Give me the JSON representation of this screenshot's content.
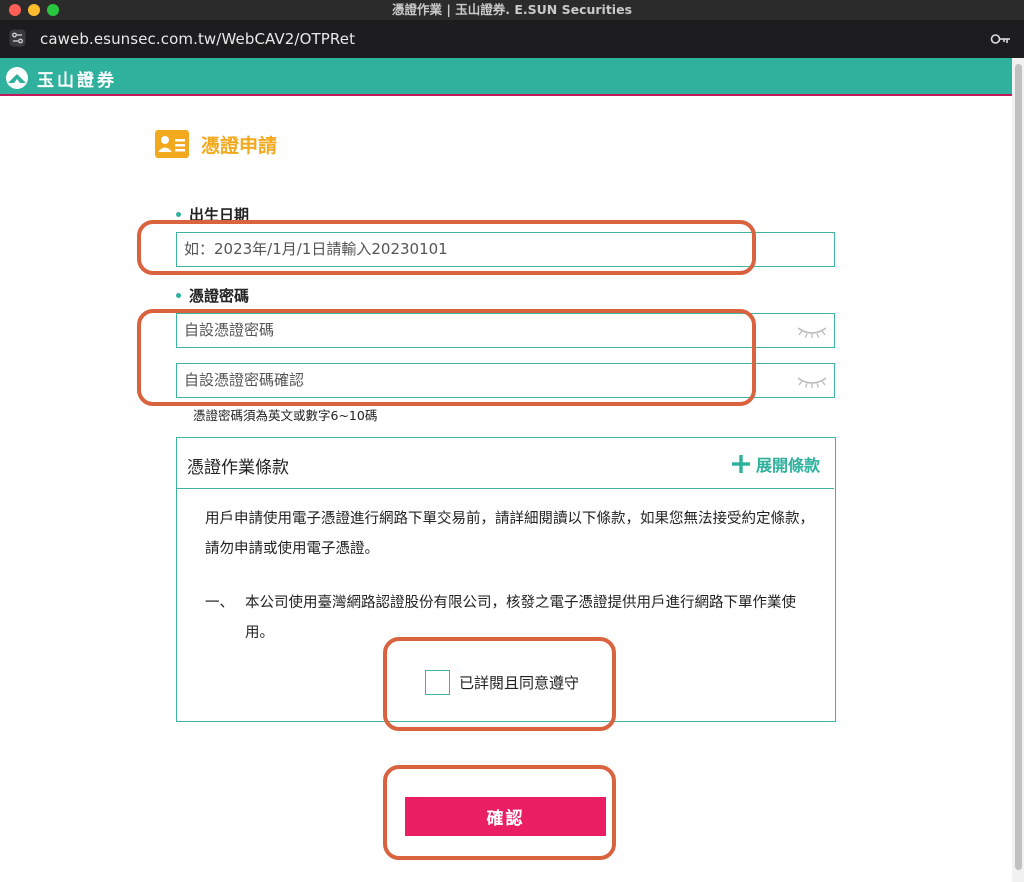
{
  "window": {
    "title": "憑證作業 | 玉山證券. E.SUN Securities"
  },
  "browser": {
    "url": "caweb.esunsec.com.tw/WebCAV2/OTPRet"
  },
  "header": {
    "logo_text": "玉山證券"
  },
  "page": {
    "title": "憑證申請"
  },
  "form": {
    "birthdate": {
      "label": "出生日期",
      "placeholder": "如：2023年/1月/1日請輸入20230101"
    },
    "password": {
      "label": "憑證密碼",
      "placeholder": "自設憑證密碼",
      "confirm_placeholder": "自設憑證密碼確認",
      "hint": "憑證密碼須為英文或數字6~10碼"
    }
  },
  "terms": {
    "title": "憑證作業條款",
    "expand_label": "展開條款",
    "intro": "用戶申請使用電子憑證進行網路下單交易前，請詳細閱讀以下條款，如果您無法接受約定條款，請勿申請或使用電子憑證。",
    "clause1_num": "一、",
    "clause1_text": "本公司使用臺灣網路認證股份有限公司，核發之電子憑證提供用戶進行網路下單作業使用。",
    "agree_label": "已詳閱且同意遵守"
  },
  "actions": {
    "confirm_label": "確認"
  },
  "colors": {
    "brand": "#2fb19d",
    "accent": "#e91e63",
    "title": "#f2a91d",
    "highlight": "#d9623f"
  },
  "icons": [
    "site-settings-icon",
    "key-icon",
    "logo-icon",
    "id-card-icon",
    "eye-closed-icon",
    "plus-icon"
  ]
}
